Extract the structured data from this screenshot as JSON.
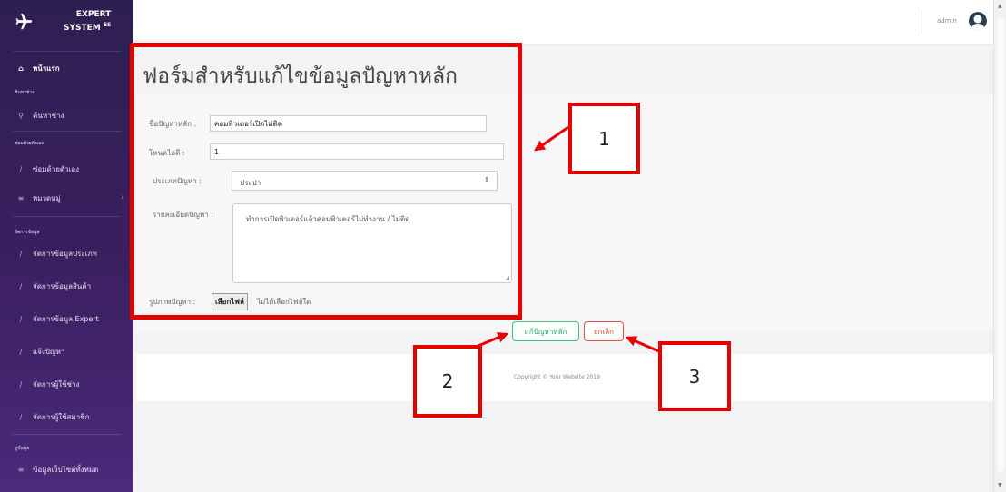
{
  "brand": {
    "line1": "EXPERT",
    "line2": "SYSTEM",
    "sup": "ES"
  },
  "sidebar": {
    "items": [
      {
        "label": "หน้าแรก",
        "icon": "home-icon"
      },
      {
        "label": "ค้นหาช่าง",
        "icon": "search-icon"
      },
      {
        "label": "ซ่อมด้วยตัวเอง",
        "icon": "wrench-icon"
      },
      {
        "label": "หมวดหมู่",
        "icon": "list-icon"
      },
      {
        "label": "จัดการข้อมูลประเภท",
        "icon": "wrench-icon"
      },
      {
        "label": "จัดการข้อมูลสินค้า",
        "icon": "wrench-icon"
      },
      {
        "label": "จัดการข้อมูล Expert",
        "icon": "wrench-icon"
      },
      {
        "label": "แจ้งปัญหา",
        "icon": "wrench-icon"
      },
      {
        "label": "จัดการผู้ใช้ช่าง",
        "icon": "wrench-icon"
      },
      {
        "label": "จัดการผู้ใช้สมาชิก",
        "icon": "wrench-icon"
      },
      {
        "label": "ข้อมูลเว็บไซต์ทั้งหมด",
        "icon": "list-icon"
      }
    ],
    "headings": [
      "ค้นหาช่าง",
      "ซ่อมด้วยตัวเอง",
      "จัดการข้อมูล",
      "ดูข้อมูล"
    ]
  },
  "topbar": {
    "user": "admin"
  },
  "page": {
    "title": "ฟอร์มสำหรับแก้ไขข้อมูลปัญหาหลัก"
  },
  "form": {
    "name_label": "ชื่อปัญหาหลัก :",
    "name_value": "คอมพิวเตอร์เปิดไม่ติด",
    "node_label": "โหนดไอดี :",
    "node_value": "1",
    "type_label": "ประเภทปัญหา :",
    "type_value": "ประปา",
    "detail_label": "รายละเอียดปัญหา :",
    "detail_value": "ทำการเปิดพิวเตอร์แล้วคอมพิวเตอร์ไม่ทำงาน / ไม่ติด",
    "image_label": "รูปภาพปัญหา :",
    "file_button": "เลือกไฟล์",
    "file_status": "ไม่ได้เลือกไฟล์ใด"
  },
  "actions": {
    "submit": "แก้ปัญหาหลัก",
    "cancel": "ยกเลิก"
  },
  "footer": {
    "copyright": "Copyright © Your Website 2019"
  },
  "annotations": [
    "1",
    "2",
    "3"
  ],
  "colors": {
    "annotation": "#e60000",
    "sidebar_top": "#2e1f52",
    "sidebar_bottom": "#4a2a7a",
    "success": "#2ecc71",
    "danger": "#e74c3c"
  }
}
